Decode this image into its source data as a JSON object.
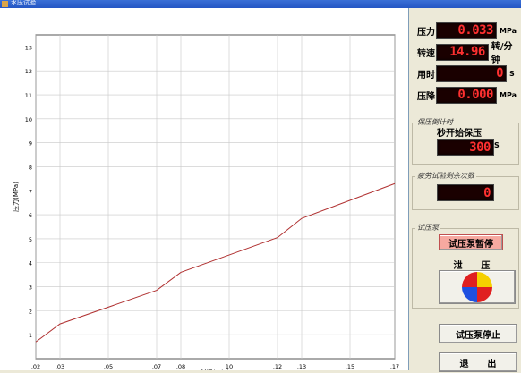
{
  "window": {
    "title": "水压试验"
  },
  "readouts": [
    {
      "label": "压力",
      "value": "0.033",
      "unit": "MPa"
    },
    {
      "label": "转速",
      "value": "14.96",
      "unit": "转/分钟"
    },
    {
      "label": "用时",
      "value": "0",
      "unit": "S"
    },
    {
      "label": "压降",
      "value": "0.000",
      "unit": "MPa"
    }
  ],
  "hold_group": {
    "title": "保压倒计时",
    "caption": "秒开始保压",
    "value": "300",
    "unit": "S"
  },
  "fatigue_group": {
    "title": "疲劳试验剩余次数",
    "value": "0"
  },
  "pump_group": {
    "title": "试压泵",
    "pause_label": "试压泵暂停",
    "release_label": "泄      压",
    "stop_label": "试压泵停止",
    "exit_label": "退      出"
  },
  "chart_data": {
    "type": "line",
    "xlabel": "时间(min)",
    "ylabel": "压力(MPa)",
    "x_ticks": [
      ".02",
      ".03",
      ".05",
      ".07",
      ".08",
      "10",
      ".12",
      ".13",
      ".15",
      ".17"
    ],
    "y_ticks": [
      "1",
      "2",
      "3",
      "4",
      "5",
      "6",
      "7",
      "8",
      "9",
      "10",
      "11",
      "12",
      "13"
    ],
    "ylim": [
      0,
      13.5
    ],
    "series": [
      {
        "color": "#b03030",
        "points": [
          {
            "x": ".02",
            "y": 0.7
          },
          {
            "x": ".03",
            "y": 1.45
          },
          {
            "x": ".07",
            "y": 2.85
          },
          {
            "x": ".08",
            "y": 3.6
          },
          {
            "x": ".12",
            "y": 5.05
          },
          {
            "x": ".13",
            "y": 5.85
          },
          {
            "x": ".17",
            "y": 7.3
          }
        ]
      }
    ],
    "grid": true
  },
  "colors": {
    "lcd_text": "#ff3030",
    "pause_button": "#f6a9a0",
    "line": "#b03030"
  }
}
